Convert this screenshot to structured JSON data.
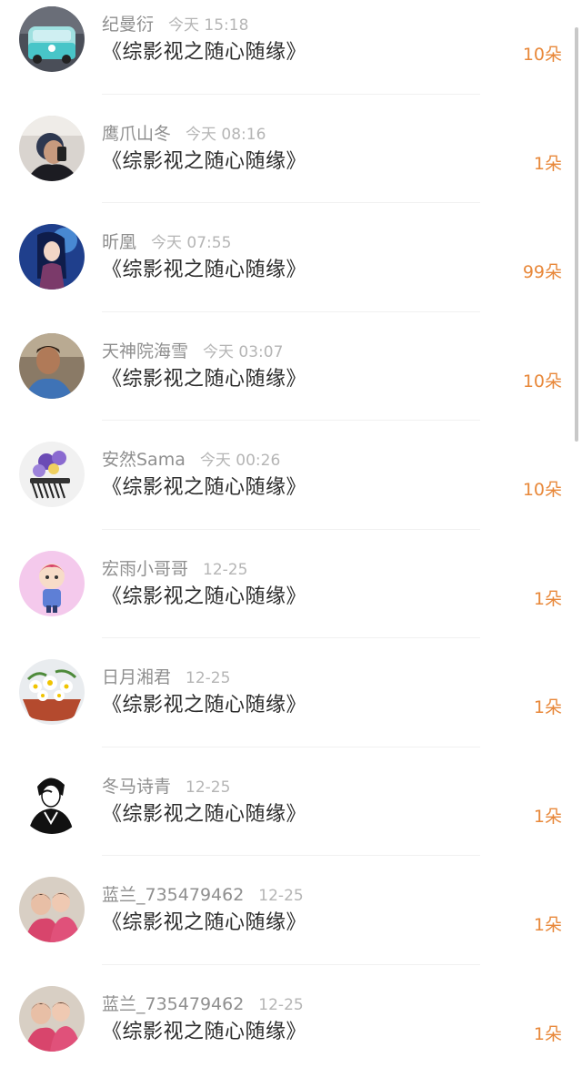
{
  "rewards": [
    {
      "name": "纪曼衍",
      "time": "今天 15:18",
      "title": "《综影视之随心随缘》",
      "amount": "10朵",
      "avatar": "vw-bus-avatar"
    },
    {
      "name": "鹰爪山冬",
      "time": "今天 08:16",
      "title": "《综影视之随心随缘》",
      "amount": "1朵",
      "avatar": "person-photo-avatar"
    },
    {
      "name": "昕凰",
      "time": "今天 07:55",
      "title": "《综影视之随心随缘》",
      "amount": "99朵",
      "avatar": "anime-girl-avatar"
    },
    {
      "name": "天神院海雪",
      "time": "今天 03:07",
      "title": "《综影视之随心随缘》",
      "amount": "10朵",
      "avatar": "boy-photo-avatar"
    },
    {
      "name": "安然Sama",
      "time": "今天 00:26",
      "title": "《综影视之随心随缘》",
      "amount": "10朵",
      "avatar": "flower-hairpin-avatar"
    },
    {
      "name": "宏雨小哥哥",
      "time": "12-25",
      "title": "《综影视之随心随缘》",
      "amount": "1朵",
      "avatar": "cartoon-boy-avatar"
    },
    {
      "name": "日月湘君",
      "time": "12-25",
      "title": "《综影视之随心随缘》",
      "amount": "1朵",
      "avatar": "daisy-bouquet-avatar"
    },
    {
      "name": "冬马诗青",
      "time": "12-25",
      "title": "《综影视之随心随缘》",
      "amount": "1朵",
      "avatar": "manga-sketch-avatar"
    },
    {
      "name": "蓝兰_735479462",
      "time": "12-25",
      "title": "《综影视之随心随缘》",
      "amount": "1朵",
      "avatar": "kids-photo-avatar"
    },
    {
      "name": "蓝兰_735479462",
      "time": "12-25",
      "title": "《综影视之随心随缘》",
      "amount": "1朵",
      "avatar": "kids-photo-avatar"
    }
  ],
  "colors": {
    "amount": "#e8883a",
    "name": "#8f8f8f",
    "time": "#b5b5b5",
    "title": "#2b2b2b"
  }
}
